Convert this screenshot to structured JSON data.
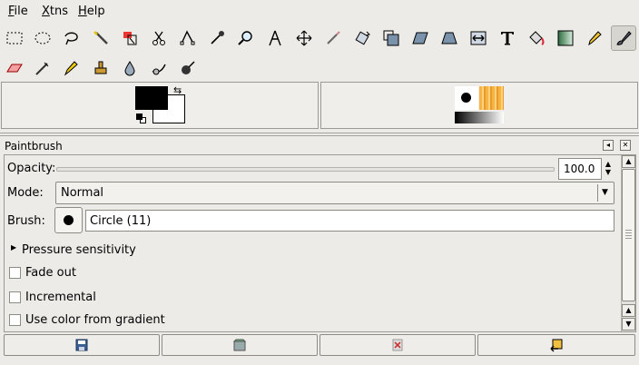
{
  "menubar": {
    "file": "File",
    "xtns": "Xtns",
    "help": "Help"
  },
  "toolbox": {
    "row1": [
      "rect-select-icon",
      "ellipse-select-icon",
      "lasso-icon",
      "fuzzy-select-icon",
      "color-select-icon",
      "scissors-icon",
      "paths-icon",
      "color-picker-icon",
      "magnify-icon",
      "measure-icon",
      "move-icon",
      "crop-icon",
      "rotate-icon",
      "scale-icon",
      "shear-icon",
      "perspective-icon",
      "flip-icon",
      "text-icon",
      "bucket-fill-icon",
      "blend-icon",
      "pencil-icon",
      "paintbrush-icon"
    ],
    "row2": [
      "eraser-icon",
      "airbrush-icon",
      "ink-icon",
      "clone-icon",
      "blur-icon",
      "smudge-icon",
      "dodge-burn-icon"
    ],
    "active": "paintbrush-icon"
  },
  "dock": {
    "title": "Paintbrush"
  },
  "options": {
    "opacity_label": "Opacity:",
    "opacity_value": "100.0",
    "mode_label": "Mode:",
    "mode_value": "Normal",
    "brush_label": "Brush:",
    "brush_value": "Circle (11)",
    "pressure_label": "Pressure sensitivity",
    "fade_label": "Fade out",
    "incremental_label": "Incremental",
    "gradient_label": "Use color from gradient",
    "fade_checked": false,
    "incremental_checked": false,
    "gradient_checked": false
  },
  "colors": {
    "foreground": "#000000",
    "background": "#ffffff",
    "accent": "#d7d5cf"
  },
  "bottom_buttons": [
    "save-icon",
    "restore-icon",
    "delete-icon",
    "reset-icon"
  ]
}
